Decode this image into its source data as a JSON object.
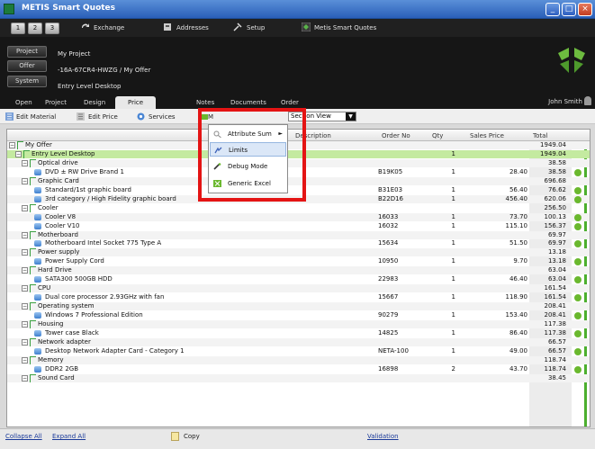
{
  "window": {
    "title": "METIS Smart Quotes"
  },
  "toolbar": {
    "numtabs": [
      "1",
      "2",
      "3"
    ],
    "exchange_label": "Exchange",
    "addresses_label": "Addresses",
    "setup_label": "Setup",
    "app_label": "Metis Smart Quotes"
  },
  "header": {
    "project_label": "Project",
    "offer_label": "Offer",
    "system_label": "System",
    "project_value": "My Project",
    "offer_value": "-16A-67CR4-HWZG / My Offer",
    "system_value": "Entry Level Desktop",
    "user_name": "John Smith"
  },
  "tabs": [
    "Open",
    "Project",
    "Design",
    "Price",
    "Notes",
    "Documents",
    "Order"
  ],
  "actions": {
    "edit_material": "Edit Material",
    "edit_price": "Edit Price",
    "services": "Services",
    "m_label": "M",
    "view_select": "Section View"
  },
  "menu": {
    "items": [
      {
        "label": "Attribute Sum",
        "icon": "magnifier-icon"
      },
      {
        "label": "Limits",
        "icon": "limits-icon"
      },
      {
        "label": "Debug Mode",
        "icon": "debug-icon"
      },
      {
        "label": "Generic Excel",
        "icon": "excel-icon"
      }
    ]
  },
  "grid": {
    "columns": {
      "description": "Description",
      "order_no": "Order No",
      "qty": "Qty",
      "sales_price": "Sales Price",
      "total": "Total"
    },
    "rows": [
      {
        "desc": "My Offer",
        "order": "",
        "qty": "",
        "price": "",
        "total": "1949.04"
      },
      {
        "desc": "Entry Level Desktop",
        "order": "",
        "qty": "1",
        "price": "",
        "total": "1949.04"
      },
      {
        "desc": "Optical drive",
        "order": "",
        "qty": "",
        "price": "",
        "total": "38.58"
      },
      {
        "desc": "DVD ± RW Drive Brand 1",
        "order": "B19K05",
        "qty": "1",
        "price": "28.40",
        "total": "38.58"
      },
      {
        "desc": "Graphic Card",
        "order": "",
        "qty": "",
        "price": "",
        "total": "696.68"
      },
      {
        "desc": "Standard/1st graphic board",
        "order": "B31E03",
        "qty": "1",
        "price": "56.40",
        "total": "76.62"
      },
      {
        "desc": "3rd category / High Fidelity graphic board",
        "order": "B22D16",
        "qty": "1",
        "price": "456.40",
        "total": "620.06"
      },
      {
        "desc": "Cooler",
        "order": "",
        "qty": "",
        "price": "",
        "total": "256.50"
      },
      {
        "desc": "Cooler V8",
        "order": "16033",
        "qty": "1",
        "price": "73.70",
        "total": "100.13"
      },
      {
        "desc": "Cooler V10",
        "order": "16032",
        "qty": "1",
        "price": "115.10",
        "total": "156.37"
      },
      {
        "desc": "Motherboard",
        "order": "",
        "qty": "",
        "price": "",
        "total": "69.97"
      },
      {
        "desc": "Motherboard Intel Socket 775 Type A",
        "order": "15634",
        "qty": "1",
        "price": "51.50",
        "total": "69.97"
      },
      {
        "desc": "Power supply",
        "order": "",
        "qty": "",
        "price": "",
        "total": "13.18"
      },
      {
        "desc": "Power Supply Cord",
        "order": "10950",
        "qty": "1",
        "price": "9.70",
        "total": "13.18"
      },
      {
        "desc": "Hard Drive",
        "order": "",
        "qty": "",
        "price": "",
        "total": "63.04"
      },
      {
        "desc": "SATA300 500GB HDD",
        "order": "22983",
        "qty": "1",
        "price": "46.40",
        "total": "63.04"
      },
      {
        "desc": "CPU",
        "order": "",
        "qty": "",
        "price": "",
        "total": "161.54"
      },
      {
        "desc": "Dual core processor 2.93GHz with fan",
        "order": "15667",
        "qty": "1",
        "price": "118.90",
        "total": "161.54"
      },
      {
        "desc": "Operating system",
        "order": "",
        "qty": "",
        "price": "",
        "total": "208.41"
      },
      {
        "desc": "Windows 7 Professional Edition",
        "order": "90279",
        "qty": "1",
        "price": "153.40",
        "total": "208.41"
      },
      {
        "desc": "Housing",
        "order": "",
        "qty": "",
        "price": "",
        "total": "117.38"
      },
      {
        "desc": "Tower case Black",
        "order": "14825",
        "qty": "1",
        "price": "86.40",
        "total": "117.38"
      },
      {
        "desc": "Network adapter",
        "order": "",
        "qty": "",
        "price": "",
        "total": "66.57"
      },
      {
        "desc": "Desktop Network Adapter Card - Category 1",
        "order": "NETA-100",
        "qty": "1",
        "price": "49.00",
        "total": "66.57"
      },
      {
        "desc": "Memory",
        "order": "",
        "qty": "",
        "price": "",
        "total": "118.74"
      },
      {
        "desc": "DDR2 2GB",
        "order": "16898",
        "qty": "2",
        "price": "43.70",
        "total": "118.74"
      },
      {
        "desc": "Sound Card",
        "order": "",
        "qty": "",
        "price": "",
        "total": "38.45"
      }
    ]
  },
  "footer": {
    "collapse_all": "Collapse All",
    "expand_all": "Expand All",
    "copy": "Copy",
    "validation": "Validation"
  }
}
